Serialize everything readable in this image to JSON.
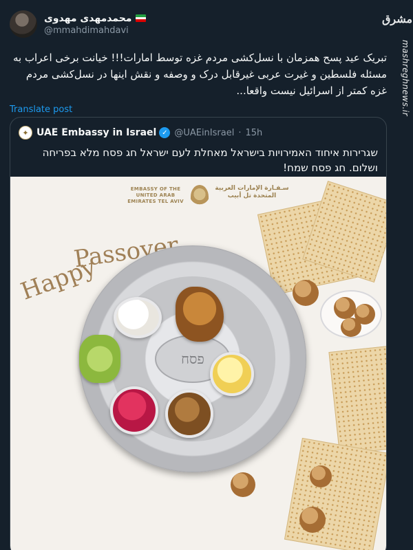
{
  "post": {
    "display_name": "محمدمهدی مهدوی",
    "handle": "@mmahdimahdavi",
    "text": "تبریک عید پسح همزمان با نسل‌کشی مردم غزه توسط امارات!!! خیانت برخی اعراب به مسئله فلسطین و غیرت عربی غیرقابل درک و وصفه و نقش اینها در نسل‌کشی مردم غزه کمتر از اسرائیل نیست واقعا...",
    "translate_label": "Translate post"
  },
  "watermark": {
    "logo_text": "مشرق",
    "url": "mashreghnews.ir"
  },
  "quote": {
    "name": "UAE Embassy in Israel",
    "handle": "@UAEinIsrael",
    "separator": "·",
    "time": "15h",
    "text": "שגרירות איחוד האמירויות בישראל מאחלת לעם ישראל חג פסח מלא בפריחה ושלום. חג פסח שמח!",
    "image": {
      "embassy_en": "EMBASSY OF THE UNITED ARAB EMIRATES TEL AVIV",
      "embassy_ar": "سـفـارة الإمارات العربية المتحدة تل أبيب",
      "greeting_word1": "Happy",
      "greeting_word2": "Passover",
      "plate_center_text": "פסח"
    }
  },
  "colors": {
    "background": "#15202b",
    "text_primary": "#f7f9f9",
    "text_secondary": "#8b98a5",
    "link": "#1d9bf0",
    "verified": "#1d9bf0",
    "border": "#38444d"
  },
  "icons": {
    "verified": "verified-badge-icon",
    "flag": "iran-flag-icon"
  }
}
